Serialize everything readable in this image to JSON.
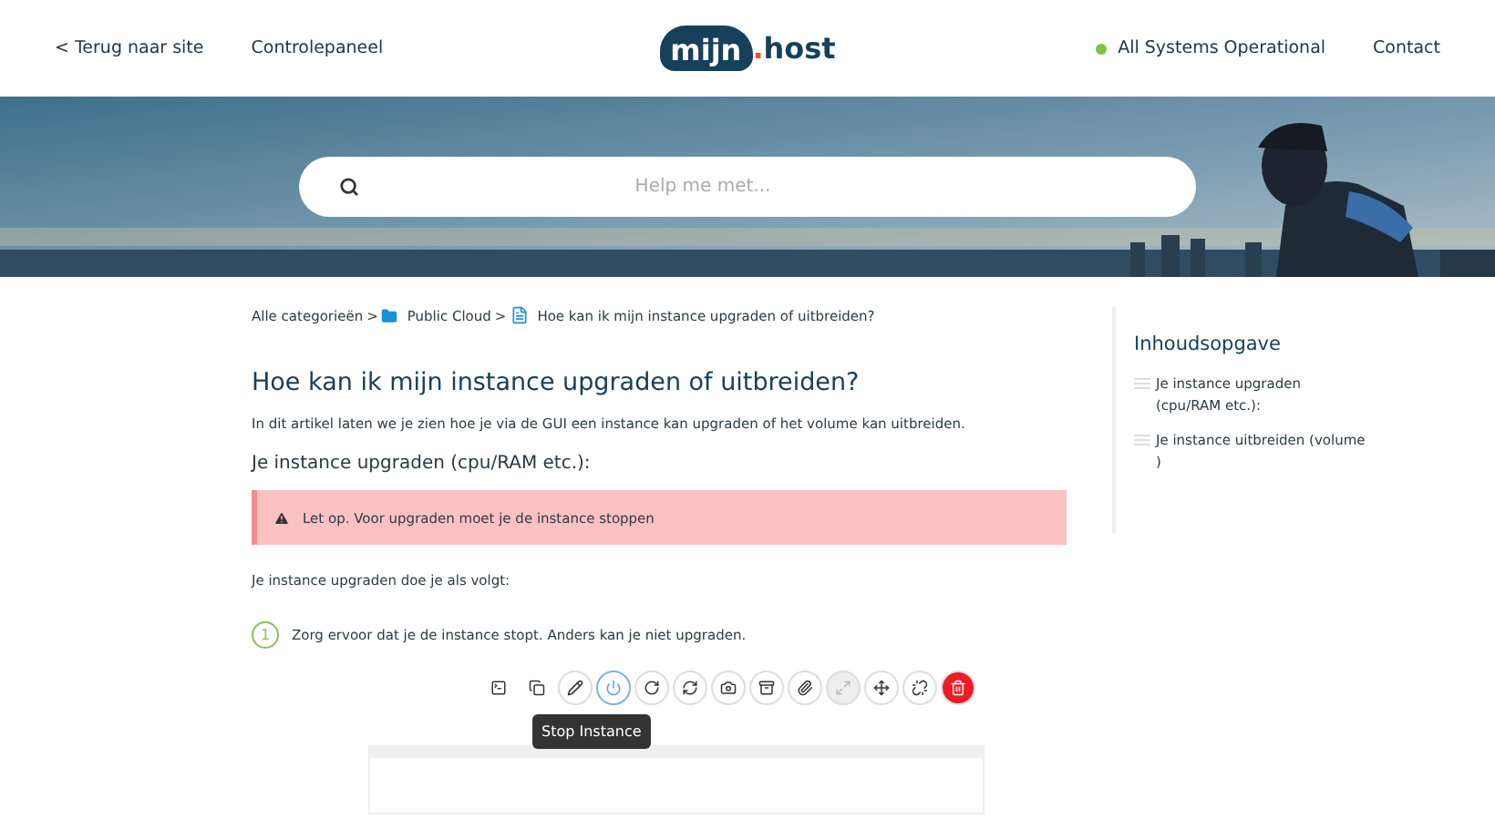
{
  "header": {
    "left_links": [
      "< Terug naar site",
      "Controlepaneel"
    ],
    "logo": {
      "primary": "mijn",
      "dot": ".",
      "secondary": "host"
    },
    "status": {
      "label": "All Systems Operational",
      "color": "#7cc34a"
    },
    "right_links": [
      "Contact"
    ]
  },
  "hero": {
    "kind": "picture",
    "search": {
      "placeholder": "Help me met..."
    }
  },
  "breadcrumb": {
    "items": [
      {
        "label": "Alle categorieën"
      },
      {
        "label": "Public Cloud"
      },
      {
        "label": "Hoe kan ik mijn instance upgraden of uitbreiden?"
      }
    ],
    "separators": [
      ">",
      ">"
    ]
  },
  "article": {
    "title": "Hoe kan ik mijn instance upgraden of uitbreiden?",
    "intro": "In dit artikel laten we je zien hoe je via de GUI een instance kan upgraden of het volume kan uitbreiden.",
    "section_title": "Je instance upgraden (cpu/RAM etc.):",
    "alert": "Let op. Voor upgraden moet je de instance stoppen",
    "lead": "Je instance upgraden doe je als volgt:",
    "steps": [
      {
        "number": "1",
        "text": "Zorg ervoor dat je de instance stopt. Anders kan je niet upgraden."
      }
    ],
    "toolbar": [
      {
        "kind": "plain",
        "selected": false,
        "disabled": false
      },
      {
        "kind": "plain",
        "selected": false,
        "disabled": false
      },
      {
        "kind": "circle",
        "selected": false,
        "disabled": false
      },
      {
        "kind": "circle",
        "selected": true,
        "disabled": false
      },
      {
        "kind": "circle",
        "selected": false,
        "disabled": false
      },
      {
        "kind": "circle",
        "selected": false,
        "disabled": false
      },
      {
        "kind": "circle",
        "selected": false,
        "disabled": false
      },
      {
        "kind": "circle",
        "selected": false,
        "disabled": false
      },
      {
        "kind": "circle",
        "selected": false,
        "disabled": false
      },
      {
        "kind": "circle",
        "selected": false,
        "disabled": true
      },
      {
        "kind": "circle",
        "selected": false,
        "disabled": false
      },
      {
        "kind": "circle",
        "selected": false,
        "disabled": false
      },
      {
        "kind": "danger",
        "selected": false,
        "disabled": false
      }
    ],
    "tooltip": "Stop Instance"
  },
  "toc": {
    "title": "Inhoudsopgave",
    "items": [
      "Je instance upgraden (cpu/RAM etc.):",
      "Je instance uitbreiden (volume )"
    ]
  }
}
